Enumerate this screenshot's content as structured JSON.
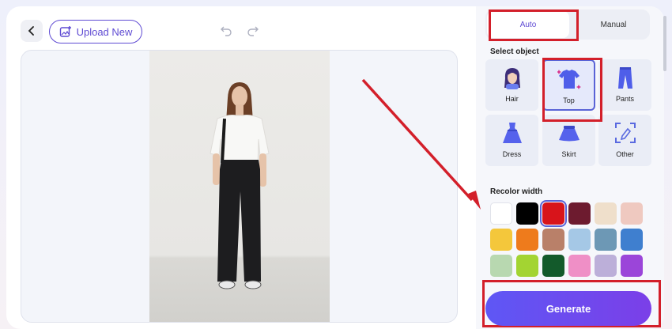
{
  "toolbar": {
    "upload_label": "Upload New"
  },
  "tabs": {
    "auto_label": "Auto",
    "manual_label": "Manual"
  },
  "select_object": {
    "title": "Select object",
    "items": [
      {
        "label": "Hair",
        "icon": "hair-icon"
      },
      {
        "label": "Top",
        "icon": "top-icon"
      },
      {
        "label": "Pants",
        "icon": "pants-icon"
      },
      {
        "label": "Dress",
        "icon": "dress-icon"
      },
      {
        "label": "Skirt",
        "icon": "skirt-icon"
      },
      {
        "label": "Other",
        "icon": "other-icon"
      }
    ],
    "selected": "Top"
  },
  "recolor": {
    "title": "Recolor width",
    "colors": [
      "#ffffff",
      "#000000",
      "#d8141b",
      "#6d1b2f",
      "#efdfcb",
      "#efc9c0",
      "#f4c73b",
      "#ee7b1c",
      "#b98069",
      "#a5c8e6",
      "#6d98b5",
      "#3f7fcf",
      "#b8d8b0",
      "#a3d432",
      "#135a2b",
      "#ef8fc6",
      "#bcafd9",
      "#9b45d9"
    ],
    "selected_index": 2
  },
  "generate_label": "Generate",
  "colors": {
    "accent": "#5f4bd3",
    "highlight": "#d31f2a"
  }
}
